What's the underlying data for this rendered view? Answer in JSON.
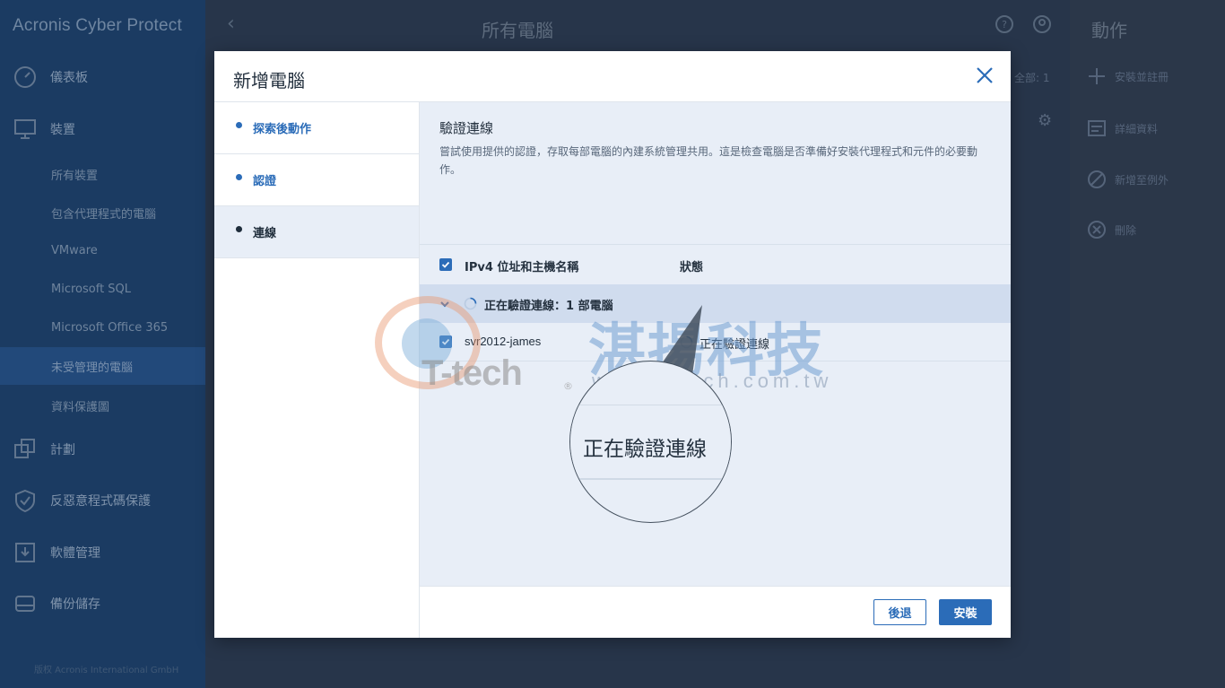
{
  "app": {
    "logo": "Acronis Cyber Protect",
    "copyright": "版权 Acronis International GmbH"
  },
  "sidebar": {
    "items": [
      {
        "label": "儀表板",
        "icon": "dashboard-icon"
      },
      {
        "label": "裝置",
        "icon": "monitor-icon"
      },
      {
        "label": "計劃",
        "icon": "plans-icon"
      },
      {
        "label": "反惡意程式碼保護",
        "icon": "shield-icon"
      },
      {
        "label": "軟體管理",
        "icon": "software-icon"
      },
      {
        "label": "備份儲存",
        "icon": "storage-icon"
      }
    ],
    "sub_items": [
      {
        "label": "所有裝置"
      },
      {
        "label": "包含代理程式的電腦"
      },
      {
        "label": "VMware"
      },
      {
        "label": "Microsoft SQL"
      },
      {
        "label": "Microsoft Office 365"
      },
      {
        "label": "未受管理的電腦"
      },
      {
        "label": "資料保護圖"
      }
    ]
  },
  "main": {
    "title": "所有電腦",
    "all_label": "全部: 1"
  },
  "actions_panel": {
    "title": "動作",
    "items": [
      {
        "label": "安裝並註冊"
      },
      {
        "label": "詳細資料"
      },
      {
        "label": "新增至例外"
      },
      {
        "label": "刪除"
      }
    ]
  },
  "dialog": {
    "title": "新增電腦",
    "steps": [
      {
        "label": "探索後動作"
      },
      {
        "label": "認證"
      },
      {
        "label": "連線"
      }
    ],
    "section_title": "驗證連線",
    "section_desc": "嘗試使用提供的認證，存取每部電腦的內建系統管理共用。這是檢查電腦是否準備好安裝代理程式和元件的必要動作。",
    "table": {
      "col_host": "IPv4 位址和主機名稱",
      "col_status": "狀態",
      "group_label": "正在驗證連線：1 部電腦",
      "rows": [
        {
          "host": "svr2012-james",
          "status": "正在驗證連線"
        }
      ]
    },
    "buttons": {
      "back": "後退",
      "install": "安裝"
    }
  },
  "overlay": {
    "watermark_brand": "T-tech",
    "watermark_reg": "®",
    "watermark_cn": "湛揚科技",
    "watermark_url": "www.t-tech.com.tw",
    "magnifier_text": "正在驗證連線"
  },
  "colors": {
    "accent": "#2b6cb8",
    "content_bg": "#e8eef7",
    "group_row_bg": "#d0dcee",
    "sidebar_bg": "#1b3b62"
  }
}
